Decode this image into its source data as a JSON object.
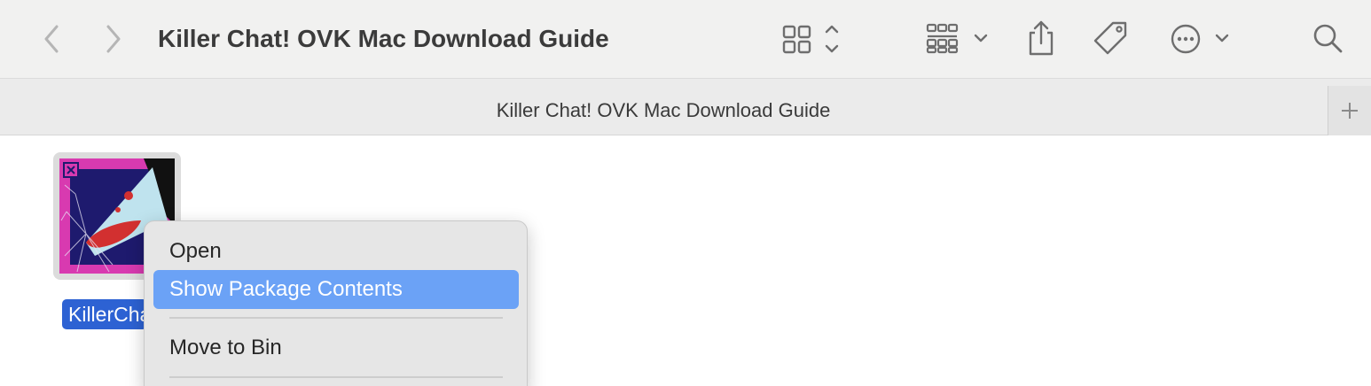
{
  "toolbar": {
    "title": "Killer Chat! OVK Mac Download Guide",
    "icons": [
      "chevron-left-icon",
      "chevron-right-icon",
      "grid-view-icon",
      "group-by-icon",
      "share-icon",
      "tag-icon",
      "more-icon",
      "search-icon"
    ]
  },
  "tabbar": {
    "tab_label": "Killer Chat! OVK Mac Download Guide",
    "new_tab_symbol": "+"
  },
  "file": {
    "label": "KillerChat"
  },
  "context_menu": {
    "items": [
      {
        "label": "Open"
      },
      {
        "label": "Show Package Contents"
      },
      {
        "label": "Move to Bin"
      }
    ]
  },
  "colors": {
    "selection": "#2d62d3",
    "menu_highlight": "#6ba2f6",
    "icon_magenta": "#d83ab0",
    "icon_navy": "#1e1a6e"
  }
}
